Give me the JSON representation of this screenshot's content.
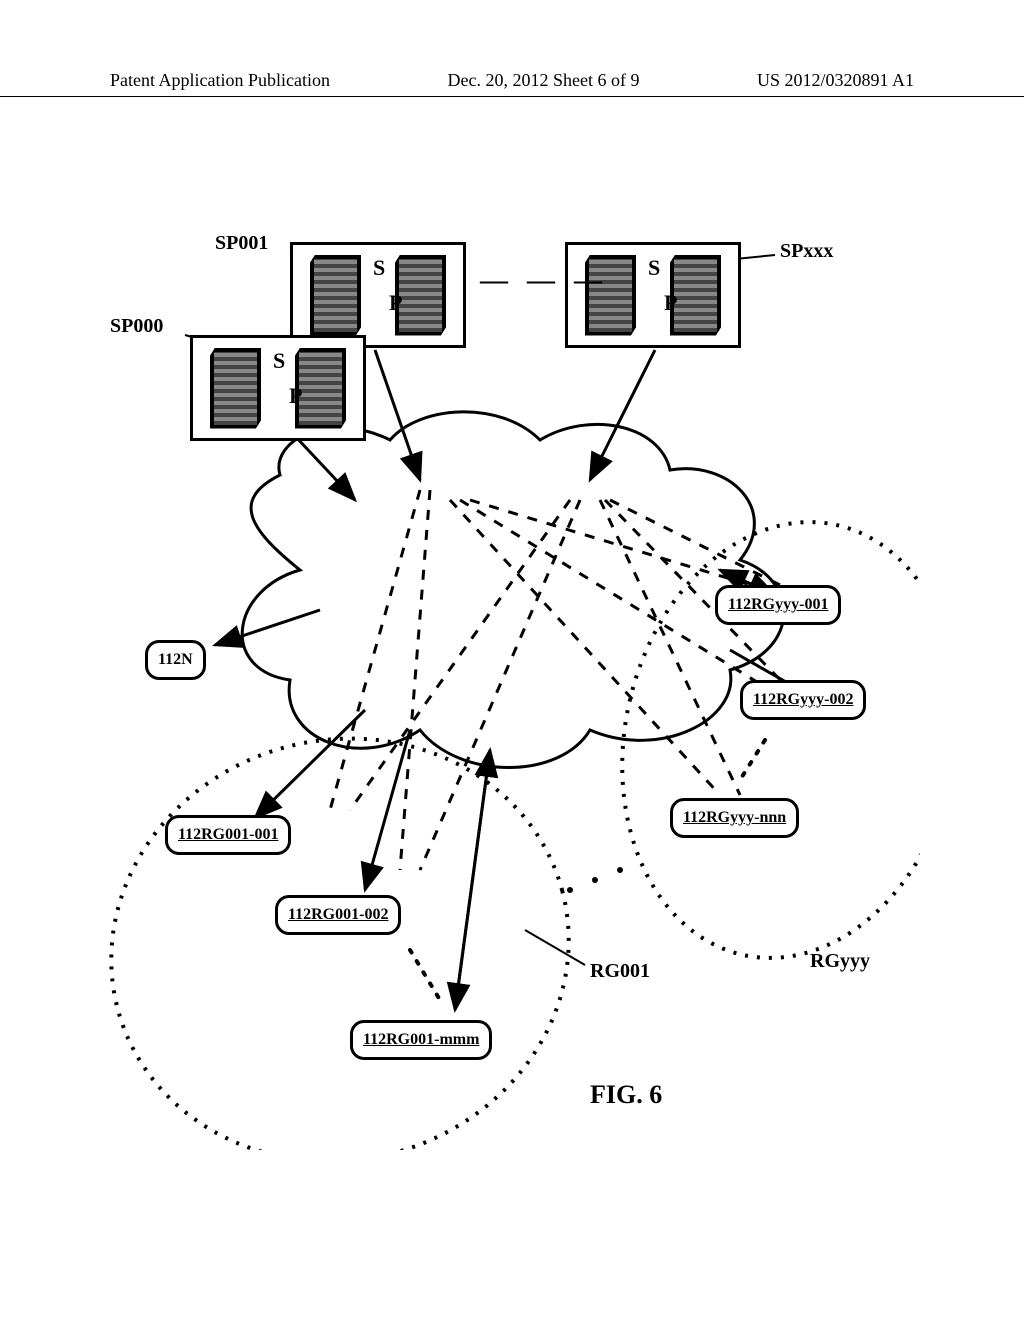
{
  "header": {
    "left": "Patent Application Publication",
    "center": "Dec. 20, 2012  Sheet 6 of 9",
    "right": "US 2012/0320891 A1"
  },
  "labels": {
    "sp000": "SP000",
    "sp001": "SP001",
    "spxxx": "SPxxx",
    "s": "S",
    "p": "P",
    "dashes": "— — —",
    "rg001": "RG001",
    "rgyyy": "RGyyy",
    "fig": "FIG. 6"
  },
  "nodes": {
    "n1": "112N",
    "rg001_001": "112RG001-001",
    "rg001_002": "112RG001-002",
    "rg001_mmm": "112RG001-mmm",
    "rgyyy_001": "112RGyyy-001",
    "rgyyy_002": "112RGyyy-002",
    "rgyyy_nnn": "112RGyyy-nnn"
  }
}
